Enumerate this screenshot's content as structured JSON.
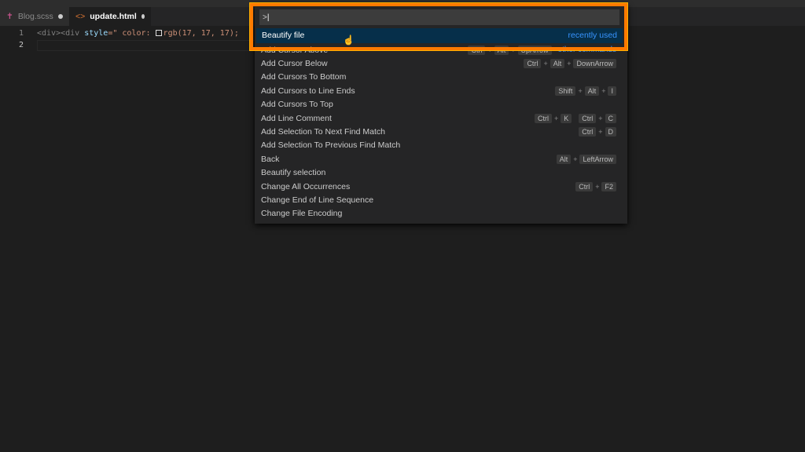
{
  "tabs": [
    {
      "label": "Blog.scss",
      "icon": "sass-icon",
      "dirty": true
    },
    {
      "label": "update.html",
      "icon": "html-icon",
      "dirty": true,
      "active": true
    }
  ],
  "editor": {
    "line_numbers": [
      "1",
      "2"
    ],
    "line1": {
      "open": "<div><div ",
      "attr": "style",
      "eq": "=\" ",
      "prop": "color: ",
      "value": "rgb(17, 17, 17);"
    }
  },
  "palette": {
    "input_value": ">",
    "selected": {
      "label": "Beautify file",
      "detail": "recently used"
    },
    "items": [
      {
        "label": "Add Cursor Above",
        "keys": [
          [
            "Ctrl",
            "Alt",
            "UpArrow"
          ]
        ],
        "detail": "other commands"
      },
      {
        "label": "Add Cursor Below",
        "keys": [
          [
            "Ctrl",
            "Alt",
            "DownArrow"
          ]
        ]
      },
      {
        "label": "Add Cursors To Bottom",
        "keys": []
      },
      {
        "label": "Add Cursors to Line Ends",
        "keys": [
          [
            "Shift",
            "Alt",
            "I"
          ]
        ]
      },
      {
        "label": "Add Cursors To Top",
        "keys": []
      },
      {
        "label": "Add Line Comment",
        "keys": [
          [
            "Ctrl",
            "K"
          ],
          [
            "Ctrl",
            "C"
          ]
        ]
      },
      {
        "label": "Add Selection To Next Find Match",
        "keys": [
          [
            "Ctrl",
            "D"
          ]
        ]
      },
      {
        "label": "Add Selection To Previous Find Match",
        "keys": []
      },
      {
        "label": "Back",
        "keys": [
          [
            "Alt",
            "LeftArrow"
          ]
        ]
      },
      {
        "label": "Beautify selection",
        "keys": []
      },
      {
        "label": "Change All Occurrences",
        "keys": [
          [
            "Ctrl",
            "F2"
          ]
        ]
      },
      {
        "label": "Change End of Line Sequence",
        "keys": []
      },
      {
        "label": "Change File Encoding",
        "keys": []
      }
    ]
  },
  "colors": {
    "highlight": "#ff7a00",
    "accent": "#3794ff",
    "selection": "#062f4a"
  }
}
